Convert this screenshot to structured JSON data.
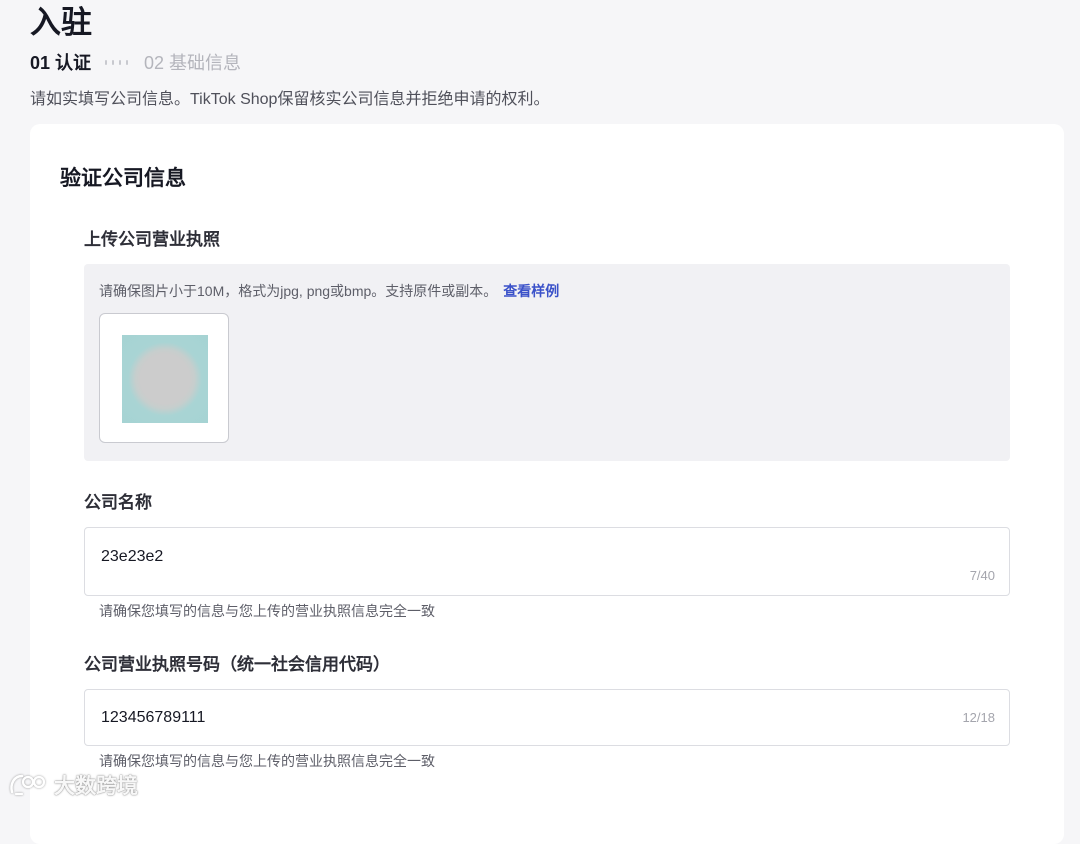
{
  "page": {
    "title": "入驻"
  },
  "steps": {
    "current": "01 认证",
    "next": "02 基础信息"
  },
  "intro": "请如实填写公司信息。TikTok Shop保留核实公司信息并拒绝申请的权利。",
  "section": {
    "title": "验证公司信息"
  },
  "upload": {
    "label": "上传公司营业执照",
    "hint": "请确保图片小于10M，格式为jpg, png或bmp。支持原件或副本。",
    "example_link": "查看样例"
  },
  "company_name": {
    "label": "公司名称",
    "value": "23e23e2",
    "counter": "7/40",
    "helper": "请确保您填写的信息与您上传的营业执照信息完全一致"
  },
  "license_number": {
    "label": "公司营业执照号码（统一社会信用代码）",
    "value": "123456789111",
    "counter": "12/18",
    "helper": "请确保您填写的信息与您上传的营业执照信息完全一致"
  },
  "watermark": {
    "text": "大数跨境"
  },
  "colors": {
    "background": "#f6f6f8",
    "card": "#ffffff",
    "link": "#3b52c9",
    "text_primary": "#161823",
    "text_secondary": "#5d5e68"
  }
}
